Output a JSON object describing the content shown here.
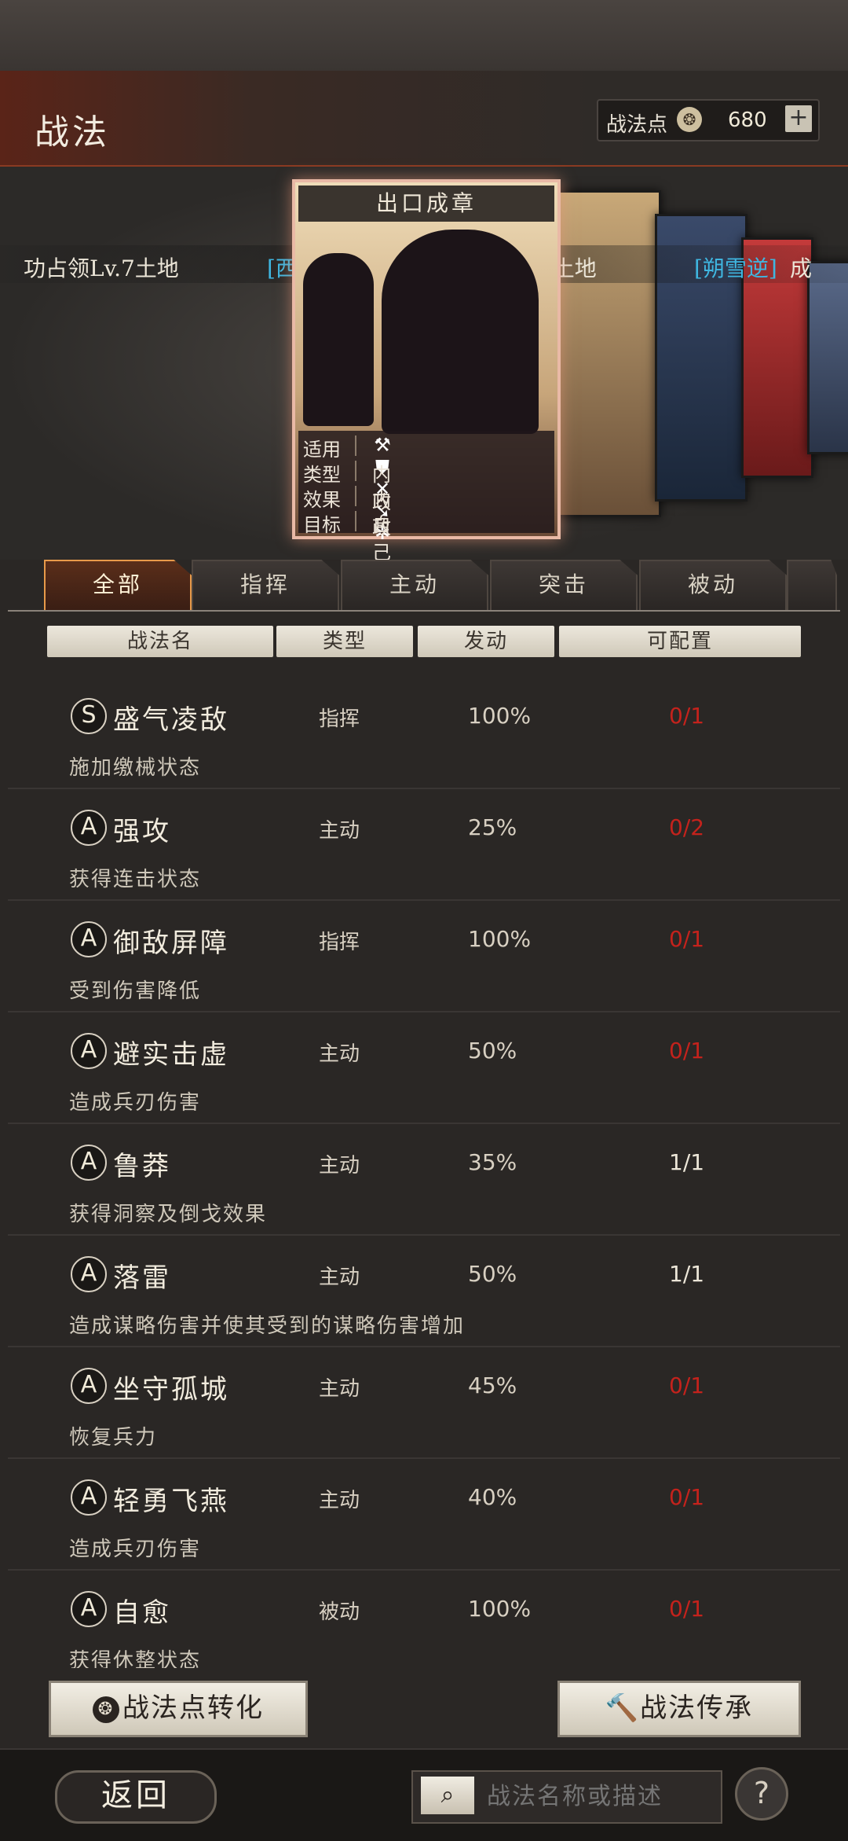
{
  "header": {
    "title": "战法",
    "points_label": "战法点",
    "points_value": "680",
    "plus_label": "+"
  },
  "ticker": {
    "segments": [
      {
        "text": "功占领Lv.7土地",
        "color": "white"
      },
      {
        "text": "[西柚渣渣辉]",
        "color": "blue"
      },
      {
        "text": "成功占领Lv.7土地",
        "color": "white"
      },
      {
        "text": "[朔雪逆]",
        "color": "blue"
      },
      {
        "text": "成",
        "color": "white"
      }
    ]
  },
  "card": {
    "name": "出口成章",
    "rows": [
      {
        "key": "适用",
        "value": ""
      },
      {
        "key": "类型",
        "value": "内政"
      },
      {
        "key": "效果",
        "value": "内政"
      },
      {
        "key": "目标",
        "value": "自己"
      }
    ],
    "weapon_icons": [
      "axe-icon",
      "shield-icon",
      "bow-icon",
      "spear-icon",
      "wheel-icon"
    ]
  },
  "tabs": [
    "全部",
    "指挥",
    "主动",
    "突击",
    "被动"
  ],
  "table": {
    "headers": [
      "战法名",
      "类型",
      "发动",
      "可配置"
    ]
  },
  "skills": [
    {
      "grade": "S",
      "name": "盛气凌敌",
      "type": "指挥",
      "rate": "100%",
      "config": "0/1",
      "config_color": "red",
      "desc": "施加缴械状态"
    },
    {
      "grade": "A",
      "name": "强攻",
      "type": "主动",
      "rate": "25%",
      "config": "0/2",
      "config_color": "red",
      "desc": "获得连击状态"
    },
    {
      "grade": "A",
      "name": "御敌屏障",
      "type": "指挥",
      "rate": "100%",
      "config": "0/1",
      "config_color": "red",
      "desc": "受到伤害降低"
    },
    {
      "grade": "A",
      "name": "避实击虚",
      "type": "主动",
      "rate": "50%",
      "config": "0/1",
      "config_color": "red",
      "desc": "造成兵刃伤害"
    },
    {
      "grade": "A",
      "name": "鲁莽",
      "type": "主动",
      "rate": "35%",
      "config": "1/1",
      "config_color": "white",
      "desc": "获得洞察及倒戈效果"
    },
    {
      "grade": "A",
      "name": "落雷",
      "type": "主动",
      "rate": "50%",
      "config": "1/1",
      "config_color": "white",
      "desc": "造成谋略伤害并使其受到的谋略伤害增加"
    },
    {
      "grade": "A",
      "name": "坐守孤城",
      "type": "主动",
      "rate": "45%",
      "config": "0/1",
      "config_color": "red",
      "desc": "恢复兵力"
    },
    {
      "grade": "A",
      "name": "轻勇飞燕",
      "type": "主动",
      "rate": "40%",
      "config": "0/1",
      "config_color": "red",
      "desc": "造成兵刃伤害"
    },
    {
      "grade": "A",
      "name": "自愈",
      "type": "被动",
      "rate": "100%",
      "config": "0/1",
      "config_color": "red",
      "desc": "获得休整状态"
    }
  ],
  "actions": {
    "convert_label": "战法点转化",
    "inherit_label": "战法传承"
  },
  "footer": {
    "back_label": "返回",
    "search_placeholder": "战法名称或描述",
    "help_label": "?"
  },
  "colors": {
    "config_red": "#c4221c",
    "ticker_blue": "#3fb6e0",
    "active_tab_border": "#e89a4a"
  }
}
